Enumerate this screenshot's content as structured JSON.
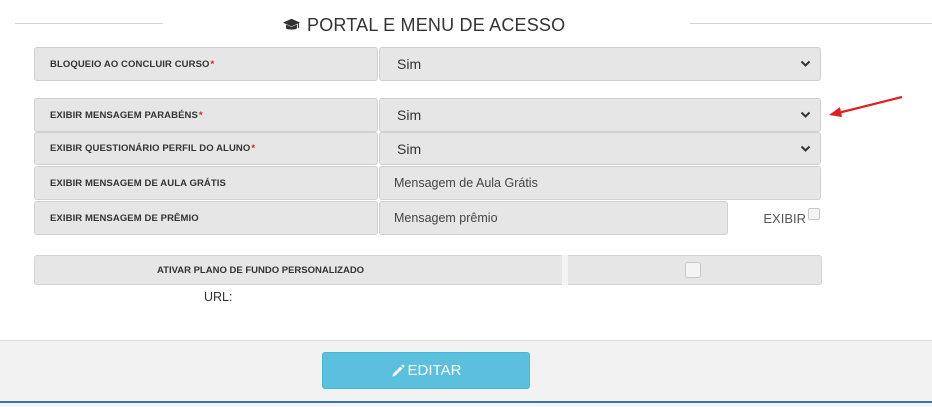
{
  "section": {
    "title": "PORTAL E MENU DE ACESSO",
    "title_icon": "graduation-cap-icon"
  },
  "form": {
    "rows": [
      {
        "label": "BLOQUEIO AO CONCLUIR CURSO",
        "required_mark": "*",
        "value": "Sim"
      },
      {
        "label": "EXIBIR MENSAGEM PARABÉNS",
        "required_mark": "*",
        "value": "Sim"
      },
      {
        "label": "EXIBIR QUESTIONÁRIO PERFIL DO ALUNO",
        "required_mark": "*",
        "value": "Sim"
      },
      {
        "label": "EXIBIR MENSAGEM DE AULA GRÁTIS",
        "value": "Mensagem de Aula Grátis"
      },
      {
        "label": "EXIBIR MENSAGEM DE PRÊMIO",
        "value": "Mensagem prêmio",
        "toggle_label": "EXIBIR"
      }
    ],
    "background": {
      "label": "ATIVAR PLANO DE FUNDO PERSONALIZADO"
    },
    "url_label": "URL:"
  },
  "footer": {
    "edit_label": "EDITAR",
    "edit_icon": "pencil-icon"
  },
  "colors": {
    "button": "#5bc0de",
    "required": "#d9201f",
    "arrow": "#e02020",
    "field_bg": "#e6e6e6"
  }
}
